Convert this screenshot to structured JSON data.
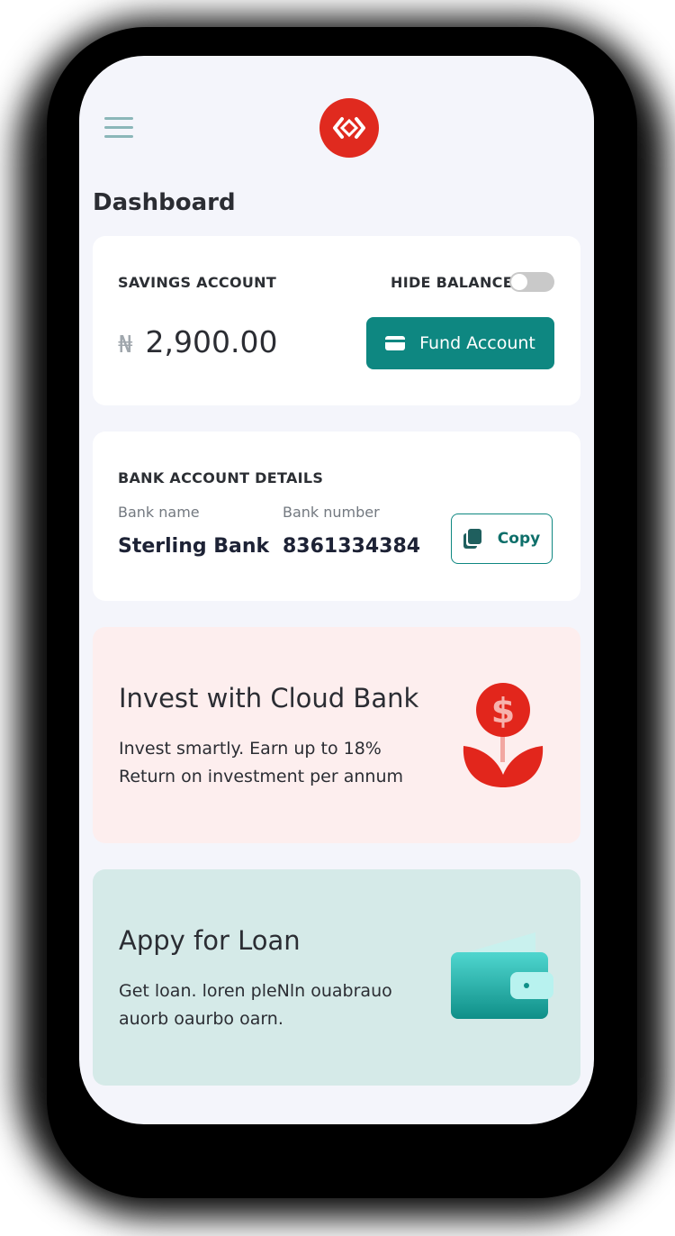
{
  "app": {
    "logo_icon": "cloud-bank-logo-icon",
    "menu_icon": "hamburger-menu-icon",
    "page_title": "Dashboard"
  },
  "savings": {
    "label": "SAVINGS ACCOUNT",
    "hide_balance_label": "HIDE BALANCE",
    "hide_balance_enabled": false,
    "currency_symbol": "₦",
    "balance": "2,900.00",
    "fund_button_label": "Fund Account",
    "fund_button_icon": "credit-card-icon"
  },
  "bank_details": {
    "title": "BANK ACCOUNT DETAILS",
    "bank_name_label": "Bank name",
    "bank_name": "Sterling Bank",
    "bank_number_label": "Bank number",
    "bank_number": "8361334384",
    "copy_label": "Copy",
    "copy_icon": "copy-icon"
  },
  "invest": {
    "title": "Invest with Cloud Bank",
    "text": "Invest smartly. Earn up to 18% Return on investment per annum",
    "icon": "money-plant-icon"
  },
  "loan": {
    "title": "Appy for Loan",
    "text": "Get loan. loren pleNln ouabrauo auorb oaurbo oarn.",
    "icon": "wallet-icon"
  },
  "colors": {
    "primary": "#0e8781",
    "brand_red": "#e02a1f",
    "invest_bg": "#fdeeee",
    "loan_bg": "#d5eae8",
    "app_bg": "#f4f5fb"
  }
}
